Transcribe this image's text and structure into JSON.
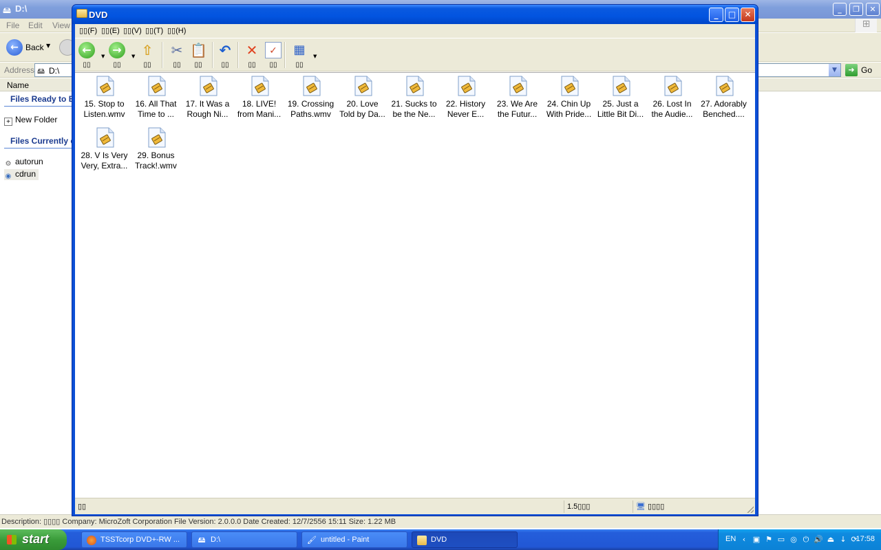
{
  "bg_window": {
    "title": "D:\\",
    "menu": [
      "File",
      "Edit",
      "View"
    ],
    "back_label": "Back",
    "address_label": "Address",
    "address_value": "D:\\",
    "go_label": "Go",
    "column_name": "Name",
    "group_ready": "Files Ready to B",
    "group_current": "Files Currently c",
    "items_ready": [
      {
        "label": "New Folder",
        "icon": "folder-plus-icon"
      }
    ],
    "items_current": [
      {
        "label": "autorun",
        "icon": "settings-file-icon"
      },
      {
        "label": "cdrun",
        "icon": "app-icon"
      }
    ],
    "description": "Description: ▯▯▯▯ Company: MicroZoft Corporation File Version: 2.0.0.0 Date Created: 12/7/2556 15:11 Size: 1.22 MB"
  },
  "dvd_window": {
    "title": "DVD",
    "menu": [
      "▯▯(F)",
      "▯▯(E)",
      "▯▯(V)",
      "▯▯(T)",
      "▯▯(H)"
    ],
    "toolbar": [
      {
        "name": "back",
        "icon": "back-arrow-icon",
        "label": "▯▯"
      },
      {
        "name": "forward",
        "icon": "forward-arrow-icon",
        "label": "▯▯"
      },
      {
        "name": "up",
        "icon": "folder-up-icon",
        "label": "▯▯"
      },
      {
        "name": "cut",
        "icon": "scissors-icon",
        "label": "▯▯"
      },
      {
        "name": "paste",
        "icon": "paste-icon",
        "label": "▯▯"
      },
      {
        "name": "undo",
        "icon": "undo-icon",
        "label": "▯▯"
      },
      {
        "name": "delete",
        "icon": "delete-x-icon",
        "label": "▯▯"
      },
      {
        "name": "properties",
        "icon": "properties-icon",
        "label": "▯▯"
      },
      {
        "name": "views",
        "icon": "views-icon",
        "label": "▯▯"
      }
    ],
    "files": [
      "15. Stop to\nListen.wmv",
      "16. All That\nTime to ...",
      "17. It Was a\nRough Ni...",
      "18. LIVE!\nfrom Mani...",
      "19. Crossing\nPaths.wmv",
      "20. Love\nTold by Da...",
      "21. Sucks to\nbe the Ne...",
      "22. History\nNever E...",
      "23. We Are\nthe Futur...",
      "24. Chin Up\nWith Pride...",
      "25. Just a\nLittle Bit Di...",
      "26. Lost In\nthe Audie...",
      "27. Adorably\nBenched....",
      "28. V Is Very\nVery, Extra...",
      "29. Bonus\nTrack!.wmv"
    ],
    "status": {
      "left": "▯▯",
      "size": "1.5▯▯▯",
      "zone": "▯▯▯▯"
    }
  },
  "taskbar": {
    "start_label": "start",
    "tasks": [
      {
        "label": "TSSTcorp DVD+-RW ...",
        "icon": "firefox-icon",
        "active": false
      },
      {
        "label": "D:\\",
        "icon": "drive-icon",
        "active": false
      },
      {
        "label": "untitled - Paint",
        "icon": "paint-icon",
        "active": false
      },
      {
        "label": "DVD",
        "icon": "folder-icon",
        "active": true
      }
    ],
    "lang": "EN",
    "clock": "17:58"
  },
  "colors": {
    "xp_blue": "#0b4fd6",
    "taskbar_blue": "#245edb",
    "start_green": "#3a9c3a",
    "chrome_beige": "#ecead8"
  }
}
